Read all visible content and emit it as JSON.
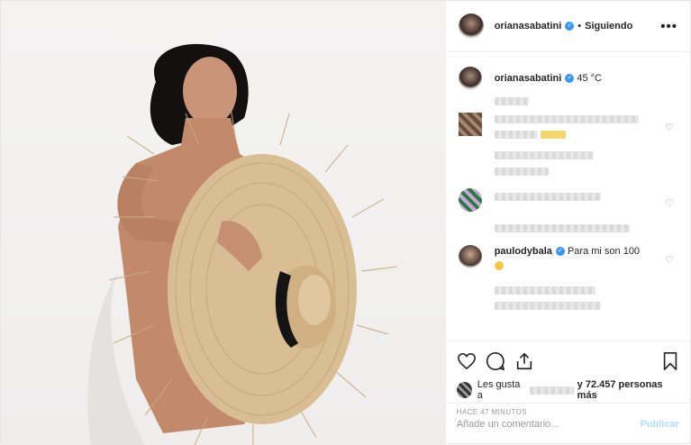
{
  "header": {
    "username": "orianasabatini",
    "separator": "•",
    "follow_status": "Siguiendo",
    "more_label": "•••"
  },
  "caption": {
    "username": "orianasabatini",
    "text": "45 °C"
  },
  "comments": [
    {
      "username": "paulodybala",
      "text": "Para mi son 100"
    }
  ],
  "likes": {
    "prefix": "Les gusta a",
    "suffix": "y 72.457 personas más"
  },
  "timestamp": "HACE 47 MINUTOS",
  "add_comment": {
    "placeholder": "Añade un comentario...",
    "publish_label": "Publicar"
  },
  "colors": {
    "verified": "#3897f0",
    "publish_disabled": "#b2dffc"
  },
  "icons": {
    "like": "heart-icon",
    "comment": "comment-icon",
    "share": "share-icon",
    "save": "bookmark-icon",
    "verified": "verified-badge-icon"
  }
}
